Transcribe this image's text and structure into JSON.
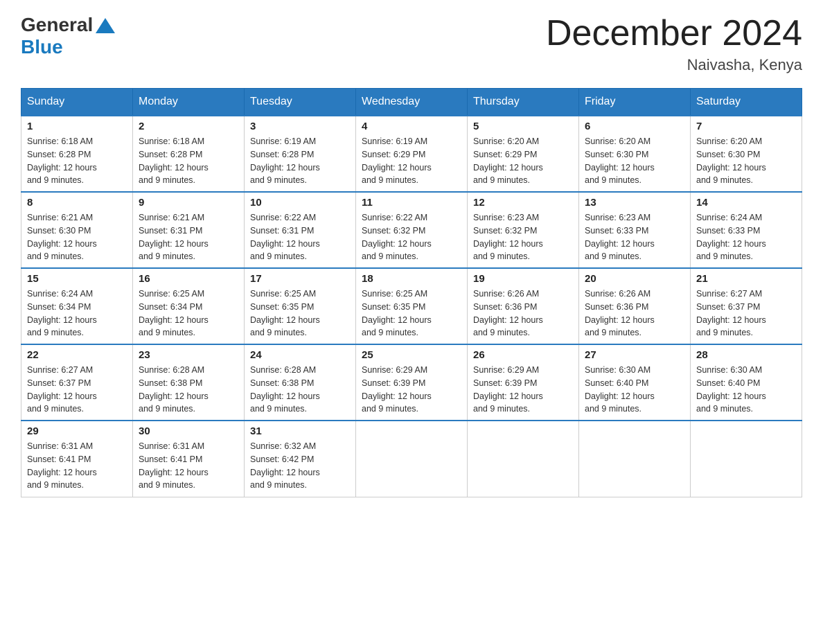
{
  "logo": {
    "general": "General",
    "blue": "Blue"
  },
  "title": "December 2024",
  "location": "Naivasha, Kenya",
  "days_of_week": [
    "Sunday",
    "Monday",
    "Tuesday",
    "Wednesday",
    "Thursday",
    "Friday",
    "Saturday"
  ],
  "weeks": [
    [
      {
        "day": "1",
        "sunrise": "6:18 AM",
        "sunset": "6:28 PM",
        "daylight": "12 hours and 9 minutes."
      },
      {
        "day": "2",
        "sunrise": "6:18 AM",
        "sunset": "6:28 PM",
        "daylight": "12 hours and 9 minutes."
      },
      {
        "day": "3",
        "sunrise": "6:19 AM",
        "sunset": "6:28 PM",
        "daylight": "12 hours and 9 minutes."
      },
      {
        "day": "4",
        "sunrise": "6:19 AM",
        "sunset": "6:29 PM",
        "daylight": "12 hours and 9 minutes."
      },
      {
        "day": "5",
        "sunrise": "6:20 AM",
        "sunset": "6:29 PM",
        "daylight": "12 hours and 9 minutes."
      },
      {
        "day": "6",
        "sunrise": "6:20 AM",
        "sunset": "6:30 PM",
        "daylight": "12 hours and 9 minutes."
      },
      {
        "day": "7",
        "sunrise": "6:20 AM",
        "sunset": "6:30 PM",
        "daylight": "12 hours and 9 minutes."
      }
    ],
    [
      {
        "day": "8",
        "sunrise": "6:21 AM",
        "sunset": "6:30 PM",
        "daylight": "12 hours and 9 minutes."
      },
      {
        "day": "9",
        "sunrise": "6:21 AM",
        "sunset": "6:31 PM",
        "daylight": "12 hours and 9 minutes."
      },
      {
        "day": "10",
        "sunrise": "6:22 AM",
        "sunset": "6:31 PM",
        "daylight": "12 hours and 9 minutes."
      },
      {
        "day": "11",
        "sunrise": "6:22 AM",
        "sunset": "6:32 PM",
        "daylight": "12 hours and 9 minutes."
      },
      {
        "day": "12",
        "sunrise": "6:23 AM",
        "sunset": "6:32 PM",
        "daylight": "12 hours and 9 minutes."
      },
      {
        "day": "13",
        "sunrise": "6:23 AM",
        "sunset": "6:33 PM",
        "daylight": "12 hours and 9 minutes."
      },
      {
        "day": "14",
        "sunrise": "6:24 AM",
        "sunset": "6:33 PM",
        "daylight": "12 hours and 9 minutes."
      }
    ],
    [
      {
        "day": "15",
        "sunrise": "6:24 AM",
        "sunset": "6:34 PM",
        "daylight": "12 hours and 9 minutes."
      },
      {
        "day": "16",
        "sunrise": "6:25 AM",
        "sunset": "6:34 PM",
        "daylight": "12 hours and 9 minutes."
      },
      {
        "day": "17",
        "sunrise": "6:25 AM",
        "sunset": "6:35 PM",
        "daylight": "12 hours and 9 minutes."
      },
      {
        "day": "18",
        "sunrise": "6:25 AM",
        "sunset": "6:35 PM",
        "daylight": "12 hours and 9 minutes."
      },
      {
        "day": "19",
        "sunrise": "6:26 AM",
        "sunset": "6:36 PM",
        "daylight": "12 hours and 9 minutes."
      },
      {
        "day": "20",
        "sunrise": "6:26 AM",
        "sunset": "6:36 PM",
        "daylight": "12 hours and 9 minutes."
      },
      {
        "day": "21",
        "sunrise": "6:27 AM",
        "sunset": "6:37 PM",
        "daylight": "12 hours and 9 minutes."
      }
    ],
    [
      {
        "day": "22",
        "sunrise": "6:27 AM",
        "sunset": "6:37 PM",
        "daylight": "12 hours and 9 minutes."
      },
      {
        "day": "23",
        "sunrise": "6:28 AM",
        "sunset": "6:38 PM",
        "daylight": "12 hours and 9 minutes."
      },
      {
        "day": "24",
        "sunrise": "6:28 AM",
        "sunset": "6:38 PM",
        "daylight": "12 hours and 9 minutes."
      },
      {
        "day": "25",
        "sunrise": "6:29 AM",
        "sunset": "6:39 PM",
        "daylight": "12 hours and 9 minutes."
      },
      {
        "day": "26",
        "sunrise": "6:29 AM",
        "sunset": "6:39 PM",
        "daylight": "12 hours and 9 minutes."
      },
      {
        "day": "27",
        "sunrise": "6:30 AM",
        "sunset": "6:40 PM",
        "daylight": "12 hours and 9 minutes."
      },
      {
        "day": "28",
        "sunrise": "6:30 AM",
        "sunset": "6:40 PM",
        "daylight": "12 hours and 9 minutes."
      }
    ],
    [
      {
        "day": "29",
        "sunrise": "6:31 AM",
        "sunset": "6:41 PM",
        "daylight": "12 hours and 9 minutes."
      },
      {
        "day": "30",
        "sunrise": "6:31 AM",
        "sunset": "6:41 PM",
        "daylight": "12 hours and 9 minutes."
      },
      {
        "day": "31",
        "sunrise": "6:32 AM",
        "sunset": "6:42 PM",
        "daylight": "12 hours and 9 minutes."
      },
      null,
      null,
      null,
      null
    ]
  ],
  "labels": {
    "sunrise": "Sunrise:",
    "sunset": "Sunset:",
    "daylight": "Daylight:"
  }
}
